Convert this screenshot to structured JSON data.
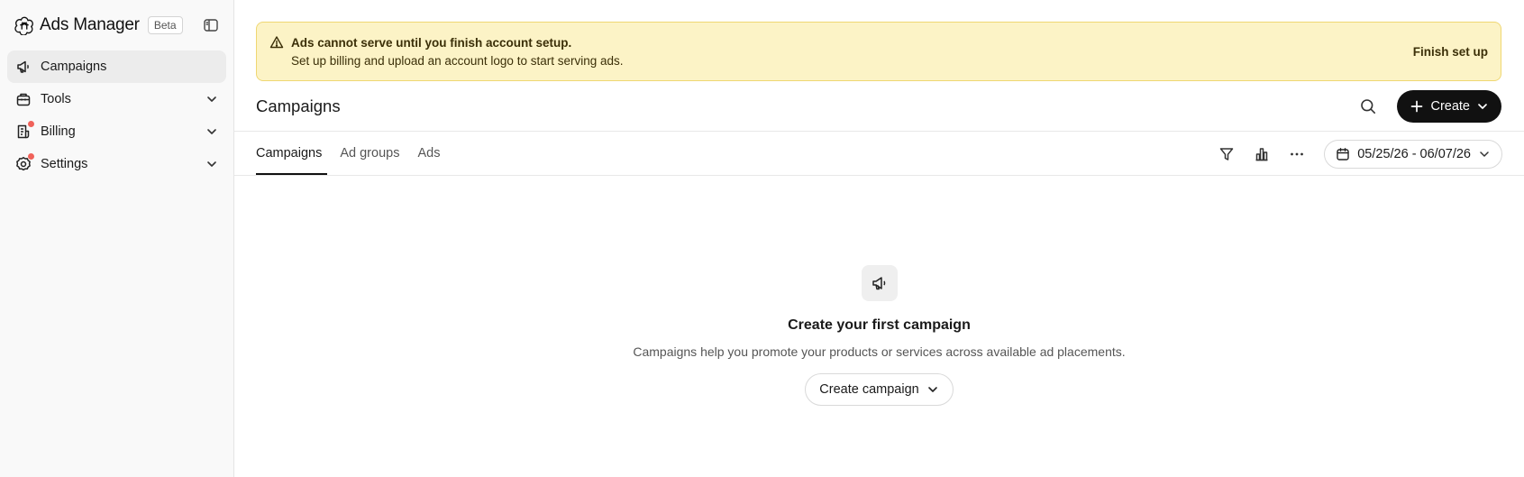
{
  "sidebar": {
    "brand": {
      "title": "Ads Manager",
      "badge": "Beta",
      "logo_icon": "openai-logo-icon",
      "collapse_icon": "sidebar-toggle-icon"
    },
    "items": [
      {
        "label": "Campaigns",
        "icon": "megaphone-icon",
        "active": true,
        "has_chevron": false,
        "has_dot": false
      },
      {
        "label": "Tools",
        "icon": "toolbox-icon",
        "active": false,
        "has_chevron": true,
        "has_dot": false
      },
      {
        "label": "Billing",
        "icon": "receipt-icon",
        "active": false,
        "has_chevron": true,
        "has_dot": true
      },
      {
        "label": "Settings",
        "icon": "gear-icon",
        "active": false,
        "has_chevron": true,
        "has_dot": true
      }
    ],
    "dot_color": "#f0625a"
  },
  "banner": {
    "title": "Ads cannot serve until you finish account setup.",
    "description": "Set up billing and upload an account logo to start serving ads.",
    "action": "Finish set up",
    "icon": "warning-triangle-icon",
    "background": "#fcf3c6",
    "border": "#efd773"
  },
  "header": {
    "title": "Campaigns",
    "create_label": "Create",
    "search_icon": "search-icon"
  },
  "tabs": [
    {
      "label": "Campaigns",
      "active": true
    },
    {
      "label": "Ad groups",
      "active": false
    },
    {
      "label": "Ads",
      "active": false
    }
  ],
  "toolbar": {
    "date_range": "05/25/26 - 06/07/26",
    "icons": [
      "filter-icon",
      "bar-chart-icon",
      "more-horizontal-icon",
      "calendar-icon"
    ]
  },
  "empty_state": {
    "title": "Create your first campaign",
    "description": "Campaigns help you promote your products or services across available ad placements.",
    "button_label": "Create campaign",
    "icon": "megaphone-icon"
  }
}
